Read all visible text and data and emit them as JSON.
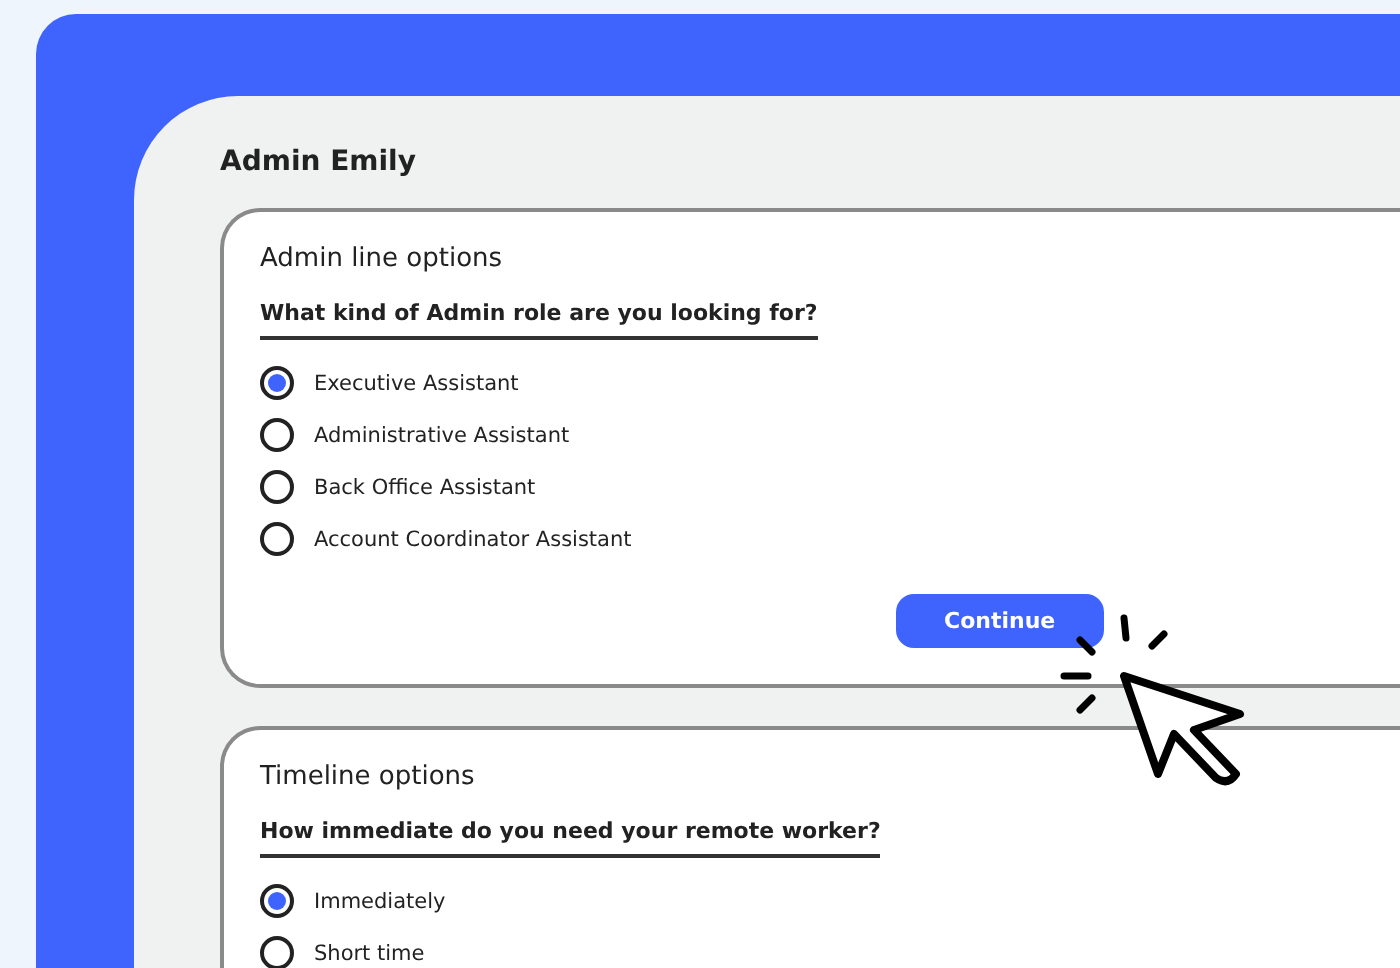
{
  "page": {
    "title": "Admin Emily"
  },
  "sections": [
    {
      "title": "Admin line options",
      "question": "What kind of Admin role are you looking for?",
      "options": [
        {
          "label": "Executive Assistant",
          "selected": true
        },
        {
          "label": "Administrative Assistant",
          "selected": false
        },
        {
          "label": "Back Office Assistant",
          "selected": false
        },
        {
          "label": "Account Coordinator Assistant",
          "selected": false
        }
      ],
      "button": "Continue"
    },
    {
      "title": "Timeline options",
      "question": "How immediate do you need your remote worker?",
      "options": [
        {
          "label": "Immediately",
          "selected": true
        },
        {
          "label": "Short time",
          "selected": false
        }
      ]
    }
  ]
}
